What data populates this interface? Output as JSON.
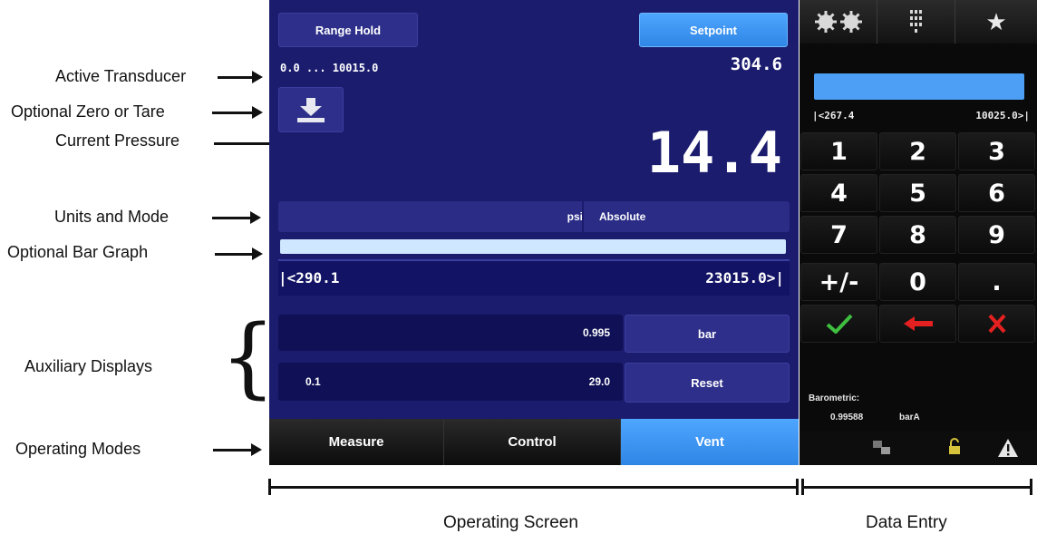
{
  "callouts": {
    "active_transducer": "Active Transducer",
    "optional_zero": "Optional Zero or Tare",
    "current_pressure": "Current Pressure",
    "units_mode": "Units and Mode",
    "bar_graph": "Optional Bar Graph",
    "aux_displays": "Auxiliary Displays",
    "operating_modes": "Operating Modes"
  },
  "operating_screen": {
    "range_hold": "Range Hold",
    "setpoint": "Setpoint",
    "transducer_range": "0.0 ... 10015.0",
    "setpoint_value": "304.6",
    "current_pressure": "14.4",
    "units": "psi",
    "mode": "Absolute",
    "bar_min": "|<290.1",
    "bar_max": "23015.0>|",
    "aux1_value": "0.995",
    "aux1_button": "bar",
    "aux2_left": "0.1",
    "aux2_value": "29.0",
    "aux2_button": "Reset",
    "tabs": [
      "Measure",
      "Control",
      "Vent"
    ]
  },
  "data_entry": {
    "range_min": "|<267.4",
    "range_max": "10025.0>|",
    "keys": [
      "1",
      "2",
      "3",
      "4",
      "5",
      "6",
      "7",
      "8",
      "9",
      "+/-",
      "0",
      "."
    ],
    "barometric_label": "Barometric:",
    "barometric_value": "0.99588",
    "barometric_unit": "barA",
    "icons": [
      "gears-icon",
      "keypad-icon",
      "star-icon",
      "accept-icon",
      "backspace-icon",
      "cancel-icon",
      "network-icon",
      "unlock-icon",
      "warning-icon"
    ]
  },
  "scale_labels": {
    "operating_screen": "Operating Screen",
    "data_entry": "Data Entry"
  },
  "colors": {
    "screen_bg": "#1b1c6e",
    "accent_blue": "#3d96f5",
    "accept_green": "#3fbf3f",
    "cancel_red": "#e52020"
  }
}
